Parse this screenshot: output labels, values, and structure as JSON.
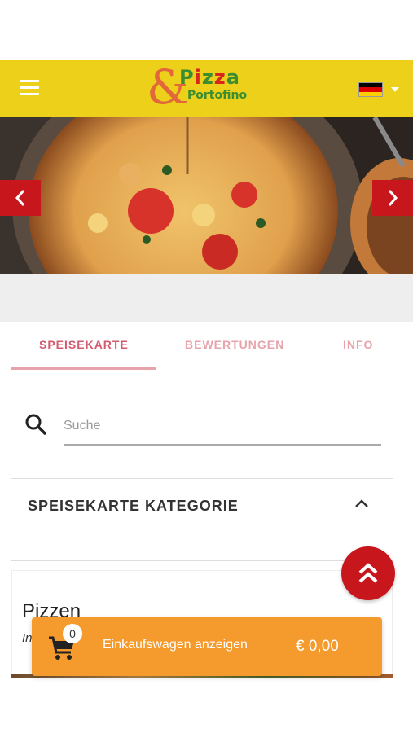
{
  "brand": {
    "logo_amp": "&",
    "logo_pizza": "Pizza",
    "logo_portofino": "Portofino",
    "header_color": "#ecd019"
  },
  "language": {
    "selected_flag": "german-flag"
  },
  "slider": {
    "prev_icon": "chevron-left-icon",
    "next_icon": "chevron-right-icon",
    "accent": "#c8161d"
  },
  "tabs": [
    {
      "label": "SPEISEKARTE",
      "active": true
    },
    {
      "label": "BEWERTUNGEN",
      "active": false
    },
    {
      "label": "INFO",
      "active": false
    }
  ],
  "search": {
    "placeholder": "Suche",
    "value": ""
  },
  "category": {
    "title": "SPEISEKARTE KATEGORIE",
    "expanded": true
  },
  "section": {
    "title": "Pizzen",
    "subtitle_partial": "In"
  },
  "cart": {
    "count": "0",
    "label": "Einkaufswagen anzeigen",
    "total": "€ 0,00",
    "color": "#f59a2c"
  }
}
